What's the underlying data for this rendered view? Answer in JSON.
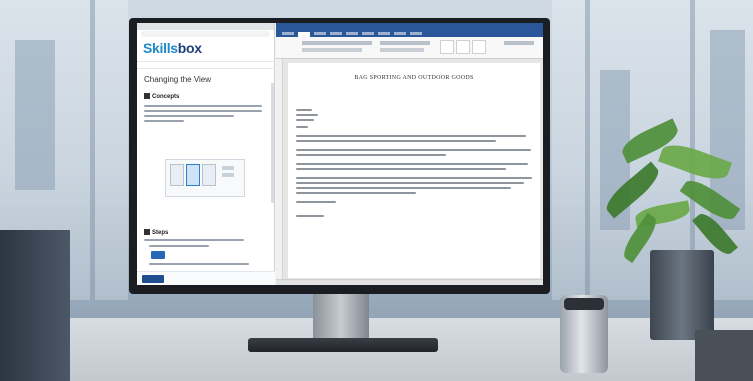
{
  "browser": {
    "logo_part1": "Skills",
    "logo_part2": "box",
    "lesson_title": "Changing the View",
    "section_concepts": "Concepts",
    "section_steps": "Steps"
  },
  "word": {
    "document_heading": "BAG SPORTING AND OUTDOOR GOODS"
  },
  "colors": {
    "skillsbox_blue": "#1f8ac8",
    "word_blue": "#2b579a",
    "plant_green": "#4f8f3a"
  }
}
